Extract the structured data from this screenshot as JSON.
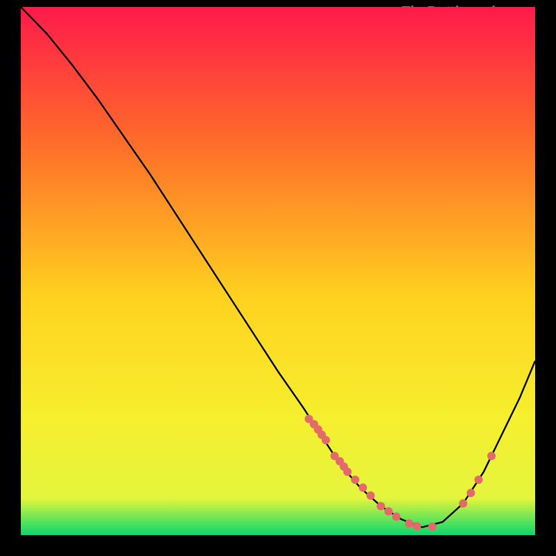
{
  "watermark": "TheBottleneck.com",
  "chart_data": {
    "type": "line",
    "title": "",
    "xlabel": "",
    "ylabel": "",
    "xlim": [
      0,
      100
    ],
    "ylim": [
      0,
      100
    ],
    "gradient_stops": [
      {
        "offset": 0,
        "color": "#ff1a4b"
      },
      {
        "offset": 25,
        "color": "#ff6a2a"
      },
      {
        "offset": 55,
        "color": "#ffd21f"
      },
      {
        "offset": 78,
        "color": "#f6ef2e"
      },
      {
        "offset": 93,
        "color": "#e4f53d"
      },
      {
        "offset": 100,
        "color": "#08d86c"
      }
    ],
    "series": [
      {
        "name": "bottleneck-curve",
        "x": [
          0,
          5,
          10,
          15,
          20,
          25,
          30,
          35,
          40,
          45,
          50,
          55,
          58,
          62,
          66,
          70,
          74,
          78,
          82,
          86,
          90,
          94,
          97,
          100
        ],
        "y": [
          100,
          95,
          89,
          82.5,
          75.5,
          68.5,
          61,
          53.5,
          46,
          38.5,
          31,
          24,
          19.5,
          13.5,
          9,
          5.5,
          3,
          1.5,
          2.5,
          6,
          12,
          20,
          26,
          33
        ]
      }
    ],
    "points": {
      "name": "scatter-dots",
      "color": "#e26a6a",
      "radius": 6,
      "x": [
        56,
        57,
        57.8,
        58.5,
        59.3,
        61,
        62,
        62.8,
        63.5,
        65,
        66.5,
        68,
        70,
        71.5,
        73,
        75.5,
        77,
        80,
        86,
        87.5,
        89,
        91.5
      ],
      "y": [
        22,
        21,
        20,
        19,
        18,
        15,
        14,
        13,
        12,
        10.5,
        9,
        7.5,
        5.5,
        4.5,
        3.5,
        2.2,
        1.7,
        1.6,
        6,
        8,
        10.5,
        15
      ]
    }
  }
}
